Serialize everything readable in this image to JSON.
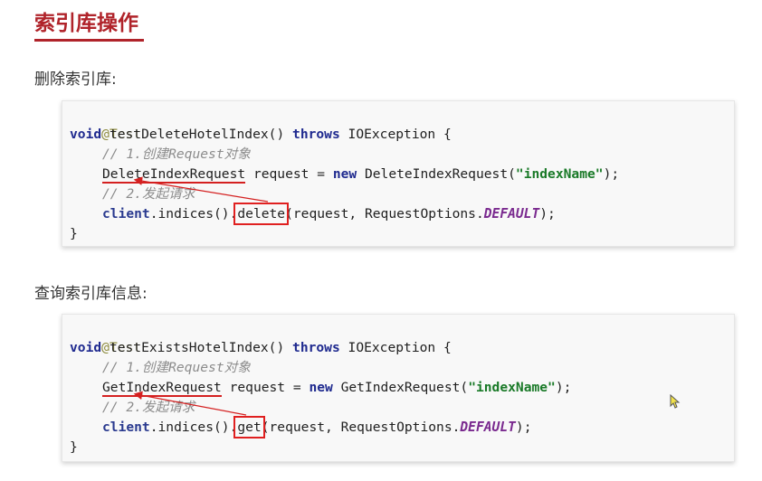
{
  "page": {
    "title": "索引库操作"
  },
  "sections": [
    {
      "heading": "删除索引库:",
      "code": {
        "annotation": "@Test",
        "kw_void": "void",
        "method_name": " testDeleteHotelIndex() ",
        "kw_throws": "throws",
        "exception_tail": " IOException {",
        "comment1": "// 1.创建Request对象",
        "request_type": "DeleteIndexRequest",
        "request_var": " request = ",
        "kw_new": "new",
        "ctor": " DeleteIndexRequest(",
        "arg": "\"indexName\"",
        "ctor_close": ");",
        "comment2": "// 2.发起请求",
        "client": "client",
        "indices": ".indices().",
        "call": "delete",
        "call_args": "(request, RequestOptions.",
        "default_const": "DEFAULT",
        "call_close": ");",
        "close_brace": "}"
      }
    },
    {
      "heading": "查询索引库信息:",
      "code": {
        "annotation": "@Test",
        "kw_void": "void",
        "method_name": " testExistsHotelIndex() ",
        "kw_throws": "throws",
        "exception_tail": " IOException {",
        "comment1": "// 1.创建Request对象",
        "request_type": "GetIndexRequest",
        "request_var": " request = ",
        "kw_new": "new",
        "ctor": " GetIndexRequest(",
        "arg": "\"indexName\"",
        "ctor_close": ");",
        "comment2": "// 2.发起请求",
        "client": "client",
        "indices": ".indices().",
        "call": "get",
        "call_args": "(request, RequestOptions.",
        "default_const": "DEFAULT",
        "call_close": ");",
        "close_brace": "}"
      }
    }
  ],
  "colors": {
    "title": "#b0232a",
    "highlight": "#e02020"
  },
  "icons": {
    "cursor": "mouse-pointer-icon"
  }
}
